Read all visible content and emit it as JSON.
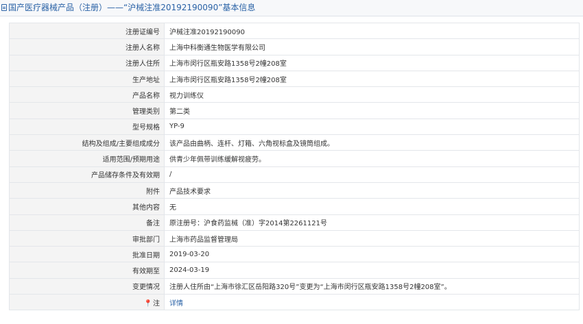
{
  "header": {
    "title": "国产医疗器械产品（注册）——“沪械注准20192190090”基本信息"
  },
  "fields": [
    {
      "label": "注册证编号",
      "value": "沪械注准20192190090"
    },
    {
      "label": "注册人名称",
      "value": "上海中科衡通生物医学有限公司"
    },
    {
      "label": "注册人住所",
      "value": "上海市闵行区瓶安路1358号2幢208室"
    },
    {
      "label": "生产地址",
      "value": "上海市闵行区瓶安路1358号2幢208室"
    },
    {
      "label": "产品名称",
      "value": "视力训练仪"
    },
    {
      "label": "管理类别",
      "value": "第二类"
    },
    {
      "label": "型号规格",
      "value": "YP-9"
    },
    {
      "label": "结构及组成/主要组成成分",
      "value": "该产品由曲柄、连杆、灯箱、六角视标盒及镜筒组成。"
    },
    {
      "label": "适用范围/预期用途",
      "value": "供青少年佩带训练缓解视疲劳。"
    },
    {
      "label": "产品储存条件及有效期",
      "value": "/"
    },
    {
      "label": "附件",
      "value": "产品技术要求"
    },
    {
      "label": "其他内容",
      "value": "无"
    },
    {
      "label": "备注",
      "value": "原注册号：沪食药监械（准）字2014第2261121号"
    },
    {
      "label": "审批部门",
      "value": "上海市药品监督管理局"
    },
    {
      "label": "批准日期",
      "value": "2019-03-20"
    },
    {
      "label": "有效期至",
      "value": "2024-03-19"
    },
    {
      "label": "变更情况",
      "value": "注册人住所由“上海市徐汇区岳阳路320号”变更为“上海市闵行区瓶安路1358号2幢208室”。"
    }
  ],
  "note_row": {
    "icon": "map-pin-icon",
    "label": "注",
    "link": "详情"
  },
  "colors": {
    "accent": "#2a62a6",
    "label_bg": "#f4f4f4",
    "border": "#e3e6ea"
  }
}
